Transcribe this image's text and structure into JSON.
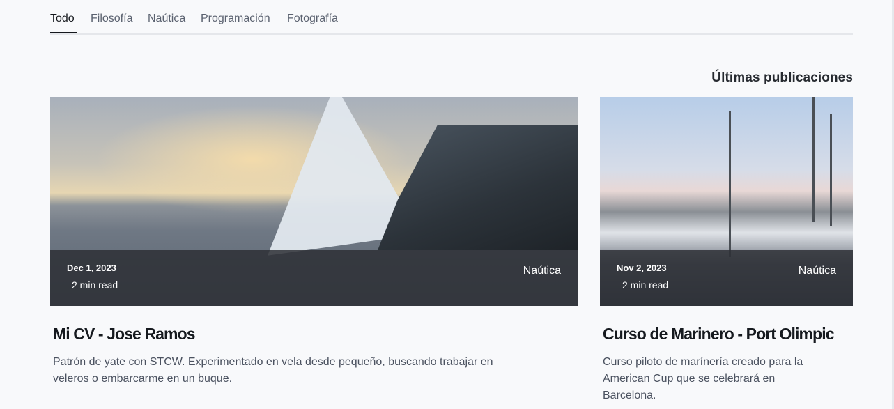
{
  "tabs": [
    {
      "label": "Todo",
      "active": true
    },
    {
      "label": "Filosofía",
      "active": false
    },
    {
      "label": "Naútica",
      "active": false
    },
    {
      "label": "Programación",
      "active": false
    },
    {
      "label": "Fotografía",
      "active": false
    }
  ],
  "section_title": "Últimas publicaciones",
  "posts": [
    {
      "date": "Dec 1, 2023",
      "read_time": "2 min read",
      "category": "Naútica",
      "title": "Mi CV - Jose Ramos",
      "description": "Patrón de yate con STCW. Experimentado en vela desde pequeño, buscando trabajar en veleros o embarcarme en un buque.",
      "image": "sailboat-sunset-photo"
    },
    {
      "date": "Nov 2, 2023",
      "read_time": "2 min read",
      "category": "Naútica",
      "title": "Curso de Marinero - Port Olimpic",
      "description": "Curso piloto de marínería creado para la American Cup que se celebrará en Barcelona.",
      "image": "marina-harbor-photo"
    }
  ]
}
